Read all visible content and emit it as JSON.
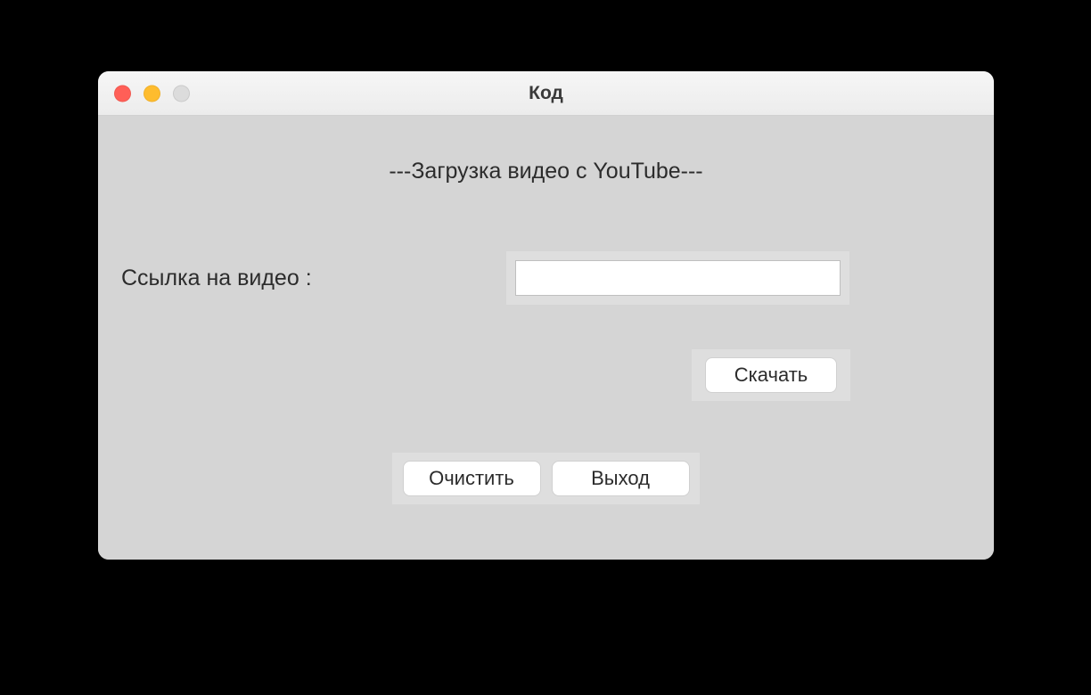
{
  "window": {
    "title": "Код"
  },
  "main": {
    "heading": "---Загрузка видео с YouTube---",
    "link_label": "Ссылка на видео :",
    "link_value": "",
    "link_placeholder": ""
  },
  "buttons": {
    "download": "Скачать",
    "clear": "Очистить",
    "exit": "Выход"
  }
}
